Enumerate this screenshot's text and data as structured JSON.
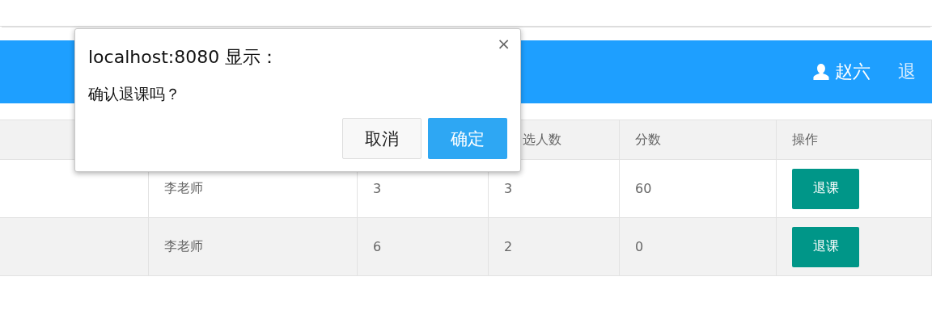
{
  "header": {
    "user": "赵六",
    "logout": "退"
  },
  "table": {
    "columns": [
      {
        "label": "选人数"
      },
      {
        "label": "分数"
      },
      {
        "label": "操作"
      }
    ],
    "rows": [
      {
        "teacher": "李老师",
        "column_3": "3",
        "column_4": "3",
        "score": "60",
        "action": "退课"
      },
      {
        "teacher": "李老师",
        "column_3": "6",
        "column_4": "2",
        "score": "0",
        "action": "退课"
      }
    ]
  },
  "dialog": {
    "title": "localhost:8080 显示：",
    "message": "确认退课吗？",
    "close": "×",
    "buttons": [
      {
        "label": "取消",
        "kind": "secondary"
      },
      {
        "label": "确定",
        "kind": "primary"
      }
    ]
  }
}
